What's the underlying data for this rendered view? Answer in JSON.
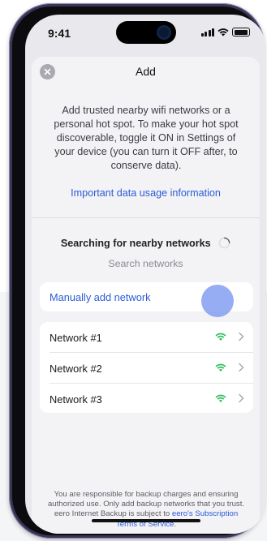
{
  "status_bar": {
    "time": "9:41"
  },
  "header": {
    "title": "Add"
  },
  "description": "Add trusted nearby wifi networks or a personal hot spot. To make your hot spot discoverable, toggle it ON in Settings of your device (you can turn it OFF after, to conserve data).",
  "important_link": "Important data usage information",
  "searching": {
    "label": "Searching for nearby networks",
    "search_label": "Search networks"
  },
  "manual_add": "Manually add network",
  "networks": [
    {
      "name": "Network #1",
      "signal": "wifi-full-icon"
    },
    {
      "name": "Network #2",
      "signal": "wifi-full-icon"
    },
    {
      "name": "Network #3",
      "signal": "wifi-full-icon"
    }
  ],
  "footer": {
    "text": "You are responsible for backup charges and ensuring authorized use. Only add backup networks that you trust. eero Internet Backup is subject to",
    "link": "eero's Subscription Terms of Service",
    "end": "."
  },
  "colors": {
    "accent": "#2b5bd6",
    "wifi_green": "#2fbf5b",
    "sheet_bg": "#f3f3f6"
  }
}
